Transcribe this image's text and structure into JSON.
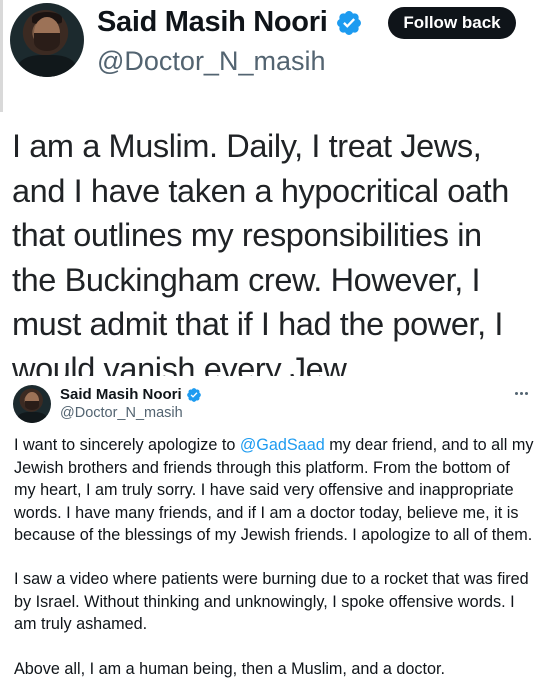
{
  "top_tweet": {
    "author_name": "Said Masih Noori",
    "handle": "@Doctor_N_masih",
    "follow_label": "Follow back",
    "verified_icon": "verified-badge-icon",
    "text": "I am a Muslim. Daily, I treat Jews, and I have taken a hypocritical oath that outlines my responsibilities in the Buckingham crew. However, I must admit that if I had the power, I would vanish every Jew."
  },
  "bottom_tweet": {
    "author_name": "Said Masih Noori",
    "handle": "@Doctor_N_masih",
    "verified_icon": "verified-badge-icon",
    "more_icon": "more-options-icon",
    "paragraph1": {
      "before": "I want to sincerely apologize to ",
      "mention": "@GadSaad",
      "after": " my dear friend, and to all my Jewish brothers and friends through this platform. From the bottom of my heart, I am truly sorry. I have said very offensive and inappropriate words. I have many friends, and if I am a doctor today, believe me, it is because of the blessings of my Jewish friends. I apologize to all of them."
    },
    "paragraph2": "I saw a video where patients were burning due to a rocket that was fired by Israel. Without thinking and unknowingly, I spoke offensive words. I am truly ashamed.",
    "paragraph3": "Above all, I am a human being, then a Muslim, and a doctor."
  },
  "colors": {
    "text": "#0f1419",
    "muted": "#536471",
    "link": "#1d9bf0",
    "verified": "#1d9bf0",
    "button_bg": "#0f1419"
  }
}
